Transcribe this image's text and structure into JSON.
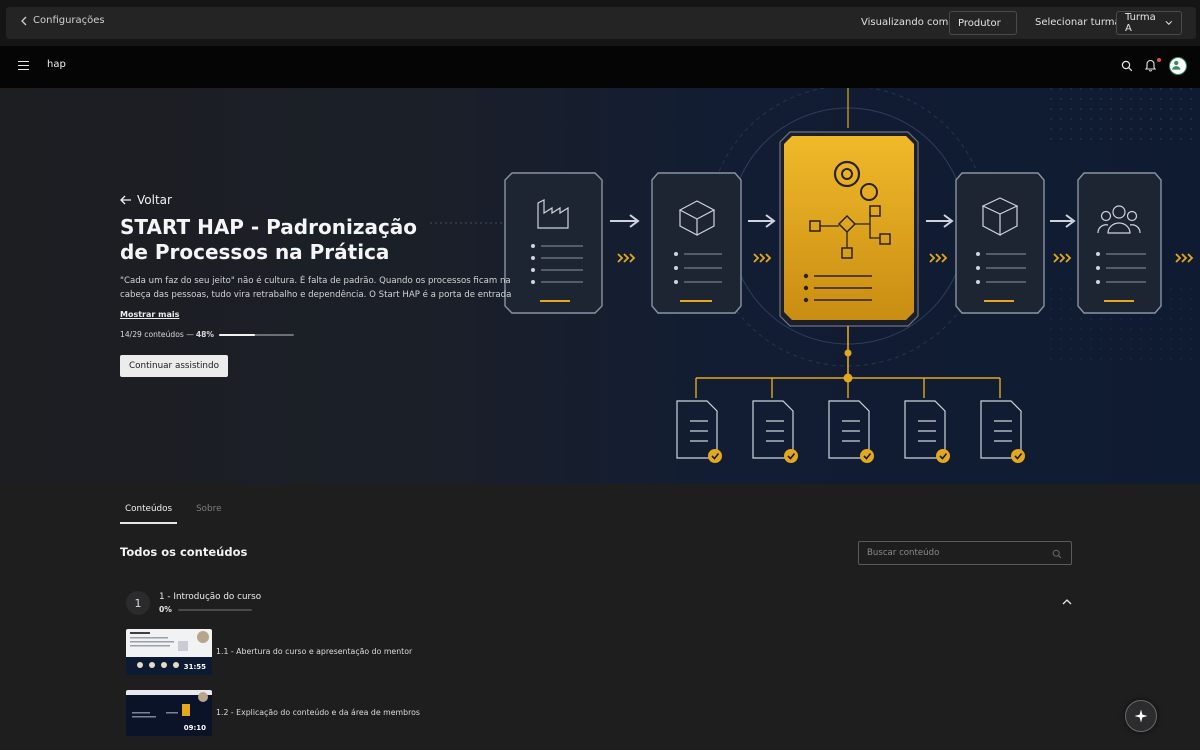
{
  "adminbar": {
    "back_label": "Configurações",
    "view_as_label": "Visualizando como:",
    "view_as_value": "Produtor",
    "class_label": "Selecionar turma:",
    "class_value": "Turma A"
  },
  "navbar": {
    "brand": "hap",
    "icons": [
      "menu-icon",
      "search-icon",
      "bell-icon",
      "avatar"
    ]
  },
  "hero": {
    "back_label": "Voltar",
    "title": "START HAP - Padronização de Processos na Prática",
    "description": "\"Cada um faz do seu jeito\" não é cultura. É falta de padrão. Quando os processos ficam na cabeça das pessoas, tudo vira retrabalho e dependência. O Start HAP é a porta de entrada da...",
    "show_more": "Mostrar mais",
    "progress_text": "14/29 conteúdos —",
    "progress_pct": "48%",
    "progress_value": 48,
    "continue_label": "Continuar assistindo",
    "accent_color": "#e3a820"
  },
  "tabs": [
    {
      "label": "Conteúdos",
      "active": true
    },
    {
      "label": "Sobre",
      "active": false
    }
  ],
  "contents": {
    "section_title": "Todos os conteúdos",
    "search_placeholder": "Buscar conteúdo",
    "module": {
      "number": "1",
      "title": "1 - Introdução do curso",
      "progress_pct": "0%",
      "progress_value": 0
    },
    "lessons": [
      {
        "title": "1.1 - Abertura do curso e apresentação do mentor",
        "duration": "31:55"
      },
      {
        "title": "1.2 - Explicação do conteúdo e da área de membros",
        "duration": "09:10"
      }
    ]
  },
  "fab": {
    "icon": "sparkle-icon"
  }
}
